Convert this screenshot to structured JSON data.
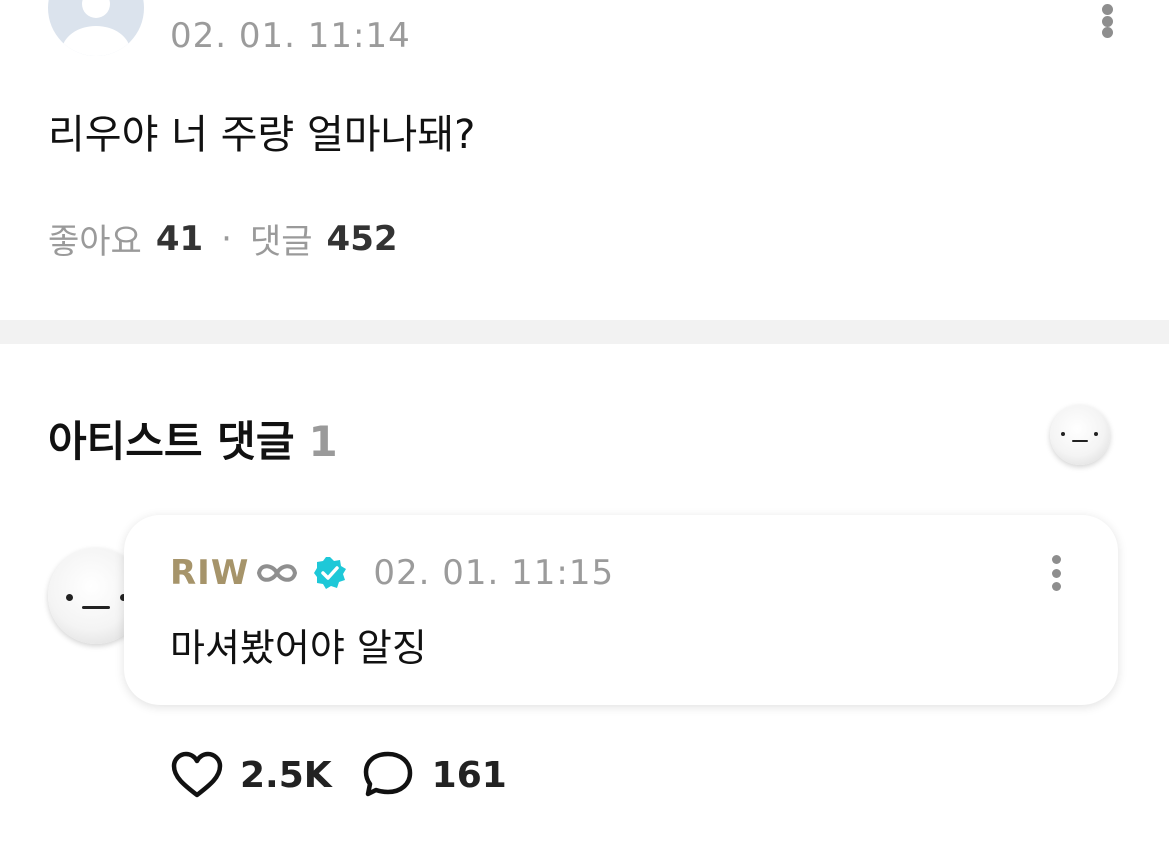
{
  "post": {
    "time": "02. 01. 11:14",
    "text": "리우야 너 주량 얼마나돼?",
    "stats": {
      "likes_label": "좋아요",
      "likes": "41",
      "separator": "·",
      "comments_label": "댓글",
      "comments": "452"
    }
  },
  "artist_comments": {
    "title": "아티스트 댓글",
    "count": "1",
    "comment": {
      "author": "RIW",
      "author_symbol": "infinity-icon",
      "verified": "verified-badge-icon",
      "time": "02. 01. 11:15",
      "text": "마셔봤어야 알징",
      "likes": "2.5K",
      "replies": "161"
    }
  },
  "colors": {
    "author": "#a6946a",
    "verified": "#1ec8d8",
    "muted": "#9b9b9b",
    "divider": "#f2f2f2"
  }
}
